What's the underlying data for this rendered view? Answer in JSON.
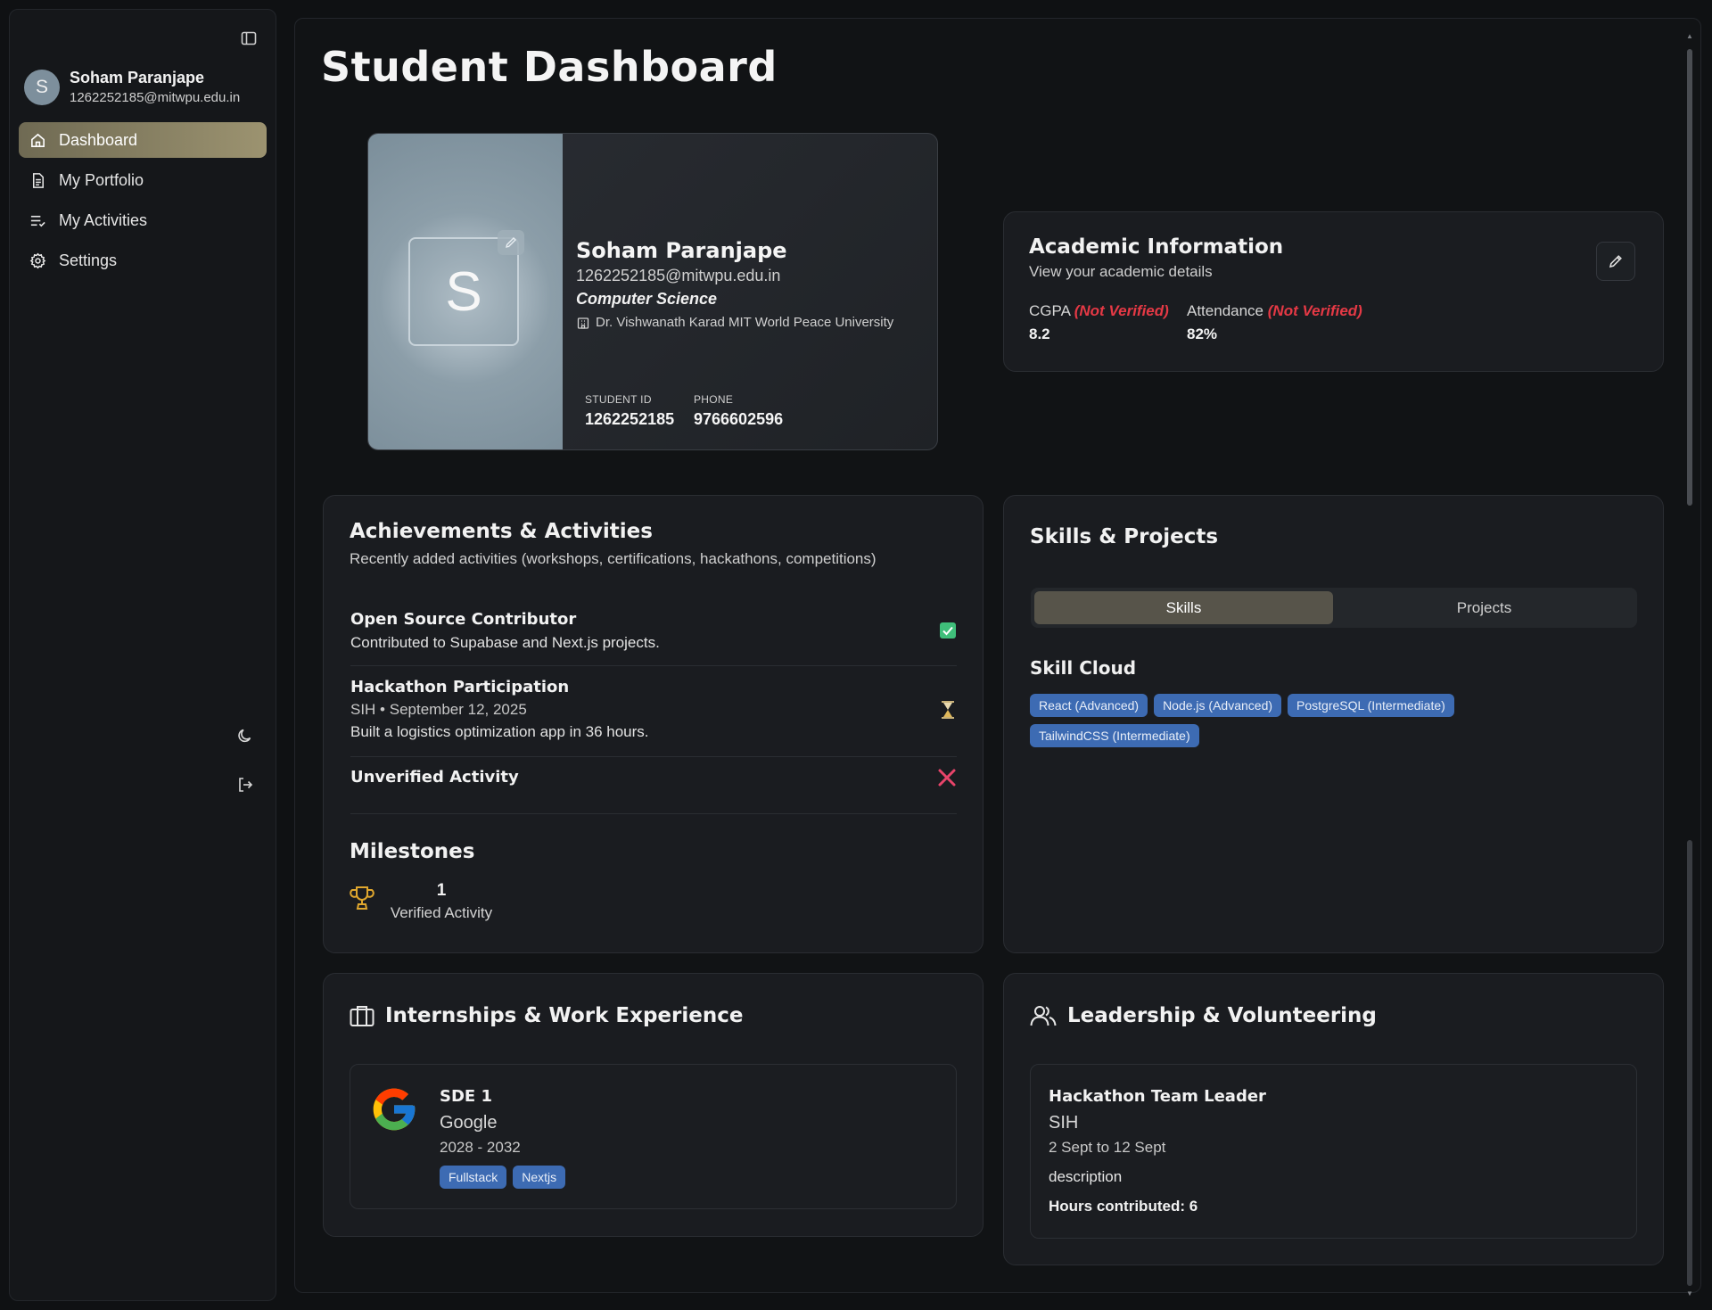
{
  "sidebar": {
    "user": {
      "initial": "S",
      "name": "Soham Paranjape",
      "email": "1262252185@mitwpu.edu.in"
    },
    "items": [
      {
        "label": "Dashboard",
        "icon": "home-icon",
        "active": true
      },
      {
        "label": "My Portfolio",
        "icon": "document-icon",
        "active": false
      },
      {
        "label": "My Activities",
        "icon": "list-icon",
        "active": false
      },
      {
        "label": "Settings",
        "icon": "gear-icon",
        "active": false
      }
    ],
    "accent": "#9c9370"
  },
  "page": {
    "title": "Student Dashboard"
  },
  "id_card": {
    "initial": "S",
    "name": "Soham Paranjape",
    "email": "1262252185@mitwpu.edu.in",
    "department": "Computer Science",
    "university": "Dr. Vishwanath Karad MIT World Peace University",
    "student_id_label": "STUDENT ID",
    "student_id": "1262252185",
    "phone_label": "PHONE",
    "phone": "9766602596"
  },
  "academic": {
    "title": "Academic Information",
    "subtitle": "View your academic details",
    "cgpa_label": "CGPA",
    "cgpa_status": "(Not Verified)",
    "cgpa": "8.2",
    "attendance_label": "Attendance",
    "attendance_status": "(Not Verified)",
    "attendance": "82%"
  },
  "achievements": {
    "title": "Achievements & Activities",
    "subtitle": "Recently added activities (workshops, certifications, hackathons, competitions)",
    "items": [
      {
        "title": "Open Source Contributor",
        "meta": "",
        "description": "Contributed to Supabase and Next.js projects.",
        "status": "verified"
      },
      {
        "title": "Hackathon Participation",
        "meta": "SIH • September 12, 2025",
        "description": "Built a logistics optimization app in 36 hours.",
        "status": "pending"
      },
      {
        "title": "Unverified Activity",
        "meta": "",
        "description": "",
        "status": "rejected"
      }
    ],
    "milestones_title": "Milestones",
    "milestone_count": "1",
    "milestone_label": "Verified Activity"
  },
  "skills": {
    "title": "Skills & Projects",
    "tabs": [
      "Skills",
      "Projects"
    ],
    "active_tab": "Skills",
    "cloud_title": "Skill Cloud",
    "chips": [
      "React (Advanced)",
      "Node.js (Advanced)",
      "PostgreSQL (Intermediate)",
      "TailwindCSS (Intermediate)"
    ]
  },
  "internships": {
    "title": "Internships & Work Experience",
    "items": [
      {
        "role": "SDE 1",
        "company": "Google",
        "period": "2028 - 2032",
        "tags": [
          "Fullstack",
          "Nextjs"
        ],
        "logo": "google-logo-icon"
      }
    ]
  },
  "leadership": {
    "title": "Leadership & Volunteering",
    "items": [
      {
        "role": "Hackathon Team Leader",
        "org": "SIH",
        "period": "2 Sept to 12 Sept",
        "description": "description",
        "hours": "Hours contributed: 6"
      }
    ]
  }
}
